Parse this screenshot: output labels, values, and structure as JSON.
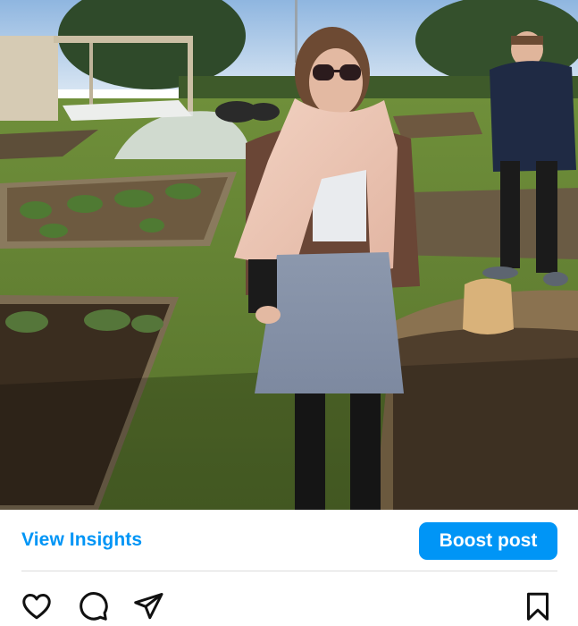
{
  "post": {
    "image_alt": "Woman in sunglasses, scarf and grey apron standing in a community garden with raised vegetable beds"
  },
  "insights": {
    "view_insights_label": "View Insights",
    "boost_post_label": "Boost post"
  },
  "actions": {
    "like_icon": "heart-outline",
    "comment_icon": "speech-bubble-outline",
    "share_icon": "paper-plane-outline",
    "save_icon": "bookmark-outline"
  },
  "colors": {
    "accent": "#0095f6",
    "divider": "#dbdbdb",
    "icon": "#111111"
  }
}
